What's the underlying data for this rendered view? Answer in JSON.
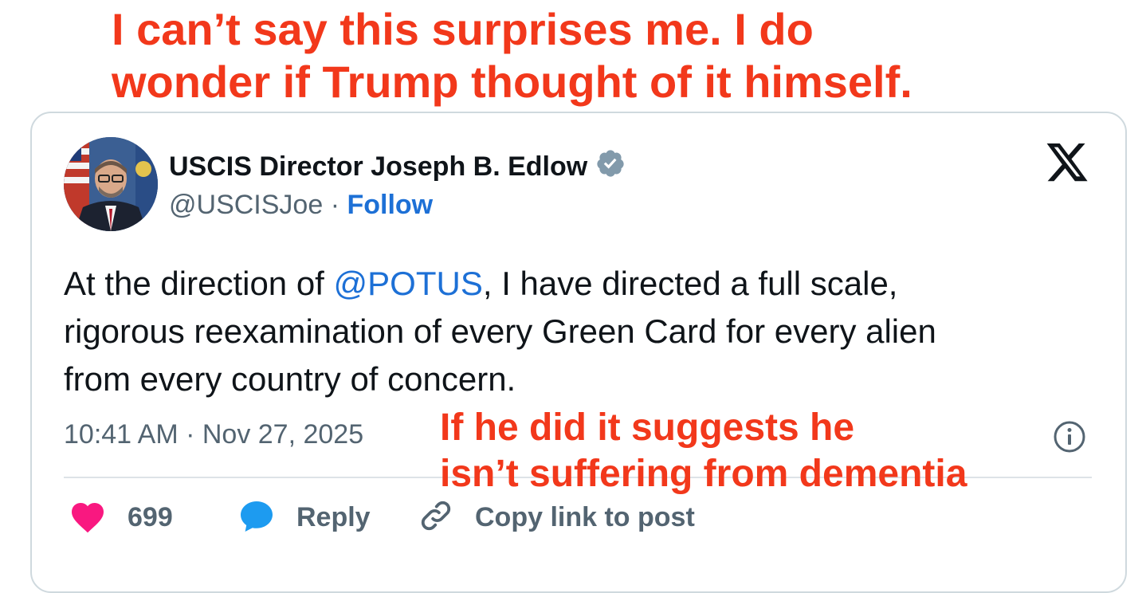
{
  "annotation": {
    "top_line1": "I can’t say this surprises me. I do",
    "top_line2": "wonder if Trump thought of it himself.",
    "bottom_line1": "If he did it suggests he",
    "bottom_line2": "isn’t suffering from dementia",
    "color": "#f2381b"
  },
  "post": {
    "display_name": "USCIS Director Joseph B. Edlow",
    "verified_icon": "verified-badge-icon",
    "handle": "@USCISJoe",
    "separator": "·",
    "follow_label": "Follow",
    "platform_icon": "x-logo-icon",
    "text": {
      "line1_prefix": "At the direction of ",
      "mention": "@POTUS",
      "line1_suffix": ", I have directed a full scale,",
      "line2": "rigorous reexamination of every Green Card for every alien",
      "line3": "from every country of concern."
    },
    "timestamp": "10:41 AM · Nov 27, 2025",
    "info_icon": "info-icon"
  },
  "actions": {
    "like_count": "699",
    "reply_label": "Reply",
    "copy_label": "Copy link to post"
  },
  "colors": {
    "accent_blue": "#1d70d6",
    "like_pink": "#f91880",
    "reply_blue": "#1d9bf0",
    "muted_text": "#536471",
    "border": "#cfd9de"
  }
}
